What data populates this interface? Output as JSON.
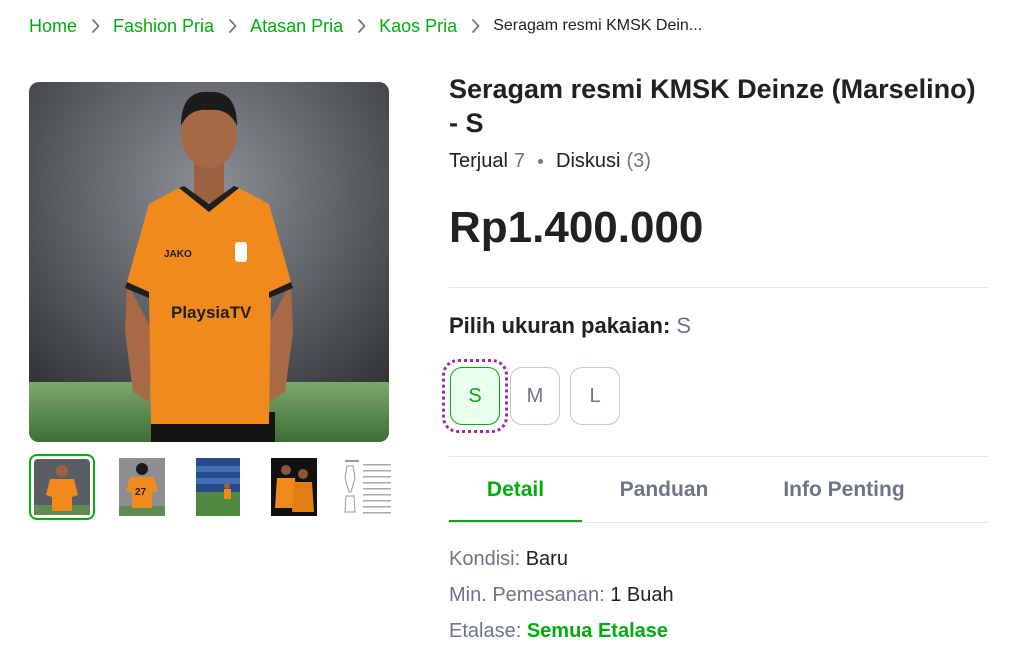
{
  "breadcrumb": {
    "items": [
      "Home",
      "Fashion Pria",
      "Atasan Pria",
      "Kaos Pria"
    ],
    "current": "Seragam resmi KMSK Dein..."
  },
  "product": {
    "title": "Seragam resmi KMSK Deinze (Marselino) - S",
    "sold_label": "Terjual",
    "sold_count": "7",
    "discussion_label": "Diskusi",
    "discussion_count": "(3)",
    "price": "Rp1.400.000",
    "jersey_text": "PlaysiaTV"
  },
  "size_selector": {
    "label": "Pilih ukuran pakaian:",
    "selected": "S",
    "options": [
      "S",
      "M",
      "L"
    ]
  },
  "tabs": [
    "Detail",
    "Panduan",
    "Info Penting"
  ],
  "details": {
    "kondisi_label": "Kondisi:",
    "kondisi_value": "Baru",
    "min_label": "Min. Pemesanan:",
    "min_value": "1 Buah",
    "etalase_label": "Etalase:",
    "etalase_value": "Semua Etalase"
  },
  "thumbnails": [
    "front-photo",
    "back-photo",
    "stadium-photo",
    "team-photo",
    "size-chart"
  ],
  "colors": {
    "brand_green": "#03ac0e",
    "selected_bg": "#ebfff0",
    "muted_text": "#6d7588",
    "jersey_orange": "#f18a1d"
  },
  "icons": {
    "breadcrumb_separator": "chevron-right-icon"
  }
}
